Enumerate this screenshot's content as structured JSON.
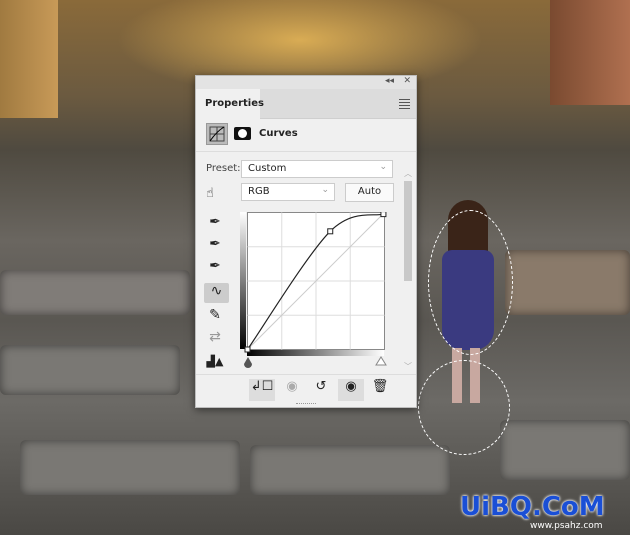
{
  "panel": {
    "title": "Properties",
    "adjustment": "Curves",
    "preset_label": "Preset:",
    "preset_value": "Custom",
    "channel_value": "RGB",
    "auto_label": "Auto",
    "collapse_glyph": "◂◂",
    "close_glyph": "✕"
  },
  "curve": {
    "channel": "RGB",
    "input_range": [
      0,
      255
    ],
    "points": [
      [
        0,
        0
      ],
      [
        154,
        220
      ],
      [
        253,
        252
      ]
    ]
  },
  "tools": [
    "eyedropper-black",
    "eyedropper-gray",
    "eyedropper-white",
    "curve-point-tool",
    "pencil-tool",
    "smooth-tool",
    "clipping-warning"
  ],
  "bottom_icons": [
    "clip-to-layer",
    "view-previous",
    "reset",
    "visibility",
    "delete"
  ],
  "watermark": {
    "logo": "UiBQ.CoM",
    "url": "www.psahz.com"
  },
  "colors": {
    "panel_bg": "#f0f0f0",
    "tab_bg": "#dcdcdc",
    "watermark": "#1a4fd6"
  }
}
